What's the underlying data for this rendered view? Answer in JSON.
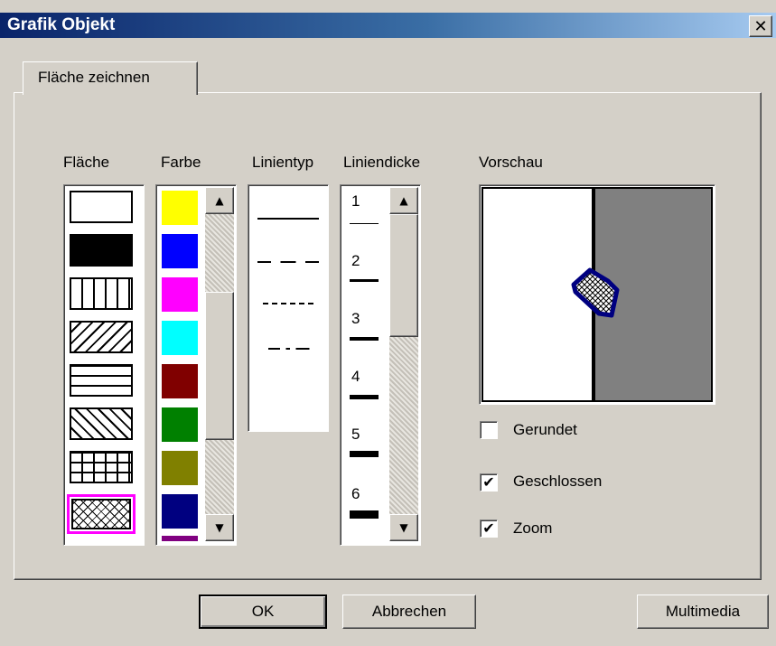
{
  "window": {
    "title": "Grafik Objekt",
    "close_glyph": "✕"
  },
  "tabs": [
    {
      "label": "Fläche zeichnen",
      "active": true
    }
  ],
  "columns": {
    "flaeche": "Fläche",
    "farbe": "Farbe",
    "linientyp": "Linientyp",
    "liniendicke": "Liniendicke",
    "vorschau": "Vorschau"
  },
  "fill_patterns": [
    "white",
    "black",
    "vertical",
    "diagonal",
    "horizontal",
    "back-diagonal",
    "grid",
    "crosshatch"
  ],
  "selected_fill": "crosshatch",
  "colors": [
    "#ffff00",
    "#0000ff",
    "#ff00ff",
    "#00ffff",
    "#800000",
    "#008000",
    "#808000",
    "#000080"
  ],
  "line_types": [
    "solid",
    "dashed",
    "dotted",
    "dash-dot"
  ],
  "line_thickness": [
    "1",
    "2",
    "3",
    "4",
    "5",
    "6"
  ],
  "checkboxes": [
    {
      "label": "Gerundet",
      "checked": false
    },
    {
      "label": "Geschlossen",
      "checked": true
    },
    {
      "label": "Zoom",
      "checked": true
    }
  ],
  "check_glyph": "✔",
  "buttons": {
    "ok": "OK",
    "cancel": "Abbrechen",
    "multimedia": "Multimedia"
  },
  "accent_colors": {
    "title_start": "#0a246a",
    "title_end": "#a6caf0",
    "selection": "#ff00ff",
    "preview_gray": "#808080",
    "preview_shape": "#000080"
  }
}
